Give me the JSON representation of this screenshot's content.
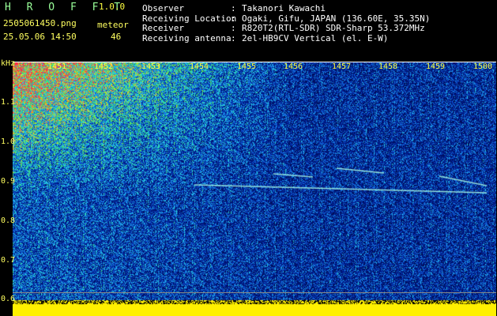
{
  "header": {
    "app_name": "H R O F F T",
    "version": "1.0.0",
    "filename": "2505061450.png",
    "datetime": "25.05.06 14:50",
    "mode_label": "meteor",
    "meteor_count": "46"
  },
  "info": [
    {
      "key": "Observer",
      "value": "Takanori Kawachi"
    },
    {
      "key": "Receiving Location",
      "value": "Ogaki, Gifu, JAPAN (136.60E, 35.35N)"
    },
    {
      "key": "Receiver",
      "value": "R820T2(RTL-SDR) SDR-Sharp 53.372MHz"
    },
    {
      "key": "Receiving antenna",
      "value": "2el-HB9CV Vertical (el. E-W)"
    }
  ],
  "axis": {
    "unit_label": "kHz",
    "y_ticks": [
      "1.1",
      "1.0",
      "0.9",
      "0.8",
      "0.7",
      "0.6"
    ],
    "x_ticks": [
      "1451",
      "1452",
      "1453",
      "1454",
      "1455",
      "1456",
      "1457",
      "1458",
      "1459",
      "1500"
    ]
  },
  "colors": {
    "background": "#000000",
    "label_yellow": "#ffff60",
    "app_green": "#99ff99",
    "spectrum_low": "#00106a",
    "spectrum_mid": "#1b7ad8",
    "spectrum_high": "#ff3030",
    "baseline": "#ffff00"
  }
}
